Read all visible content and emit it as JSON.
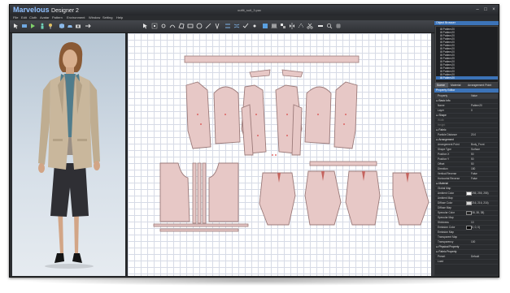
{
  "app": {
    "name": "Marvelous",
    "name_suffix": "Designer 2",
    "document_title": "outfit_suit_3.pac"
  },
  "menu": [
    "File",
    "Edit",
    "Cloth",
    "Avatar",
    "Pattern",
    "Environment",
    "Window",
    "Setting",
    "Help"
  ],
  "toolbar_3d_icons": [
    "select-icon",
    "transform-icon",
    "simulate-icon",
    "avatar-icon",
    "pin-icon",
    "fold-icon",
    "iron-icon",
    "camera-icon",
    "arrow-icon"
  ],
  "toolbar_2d_icons": [
    "select-pattern-icon",
    "edit-point-icon",
    "add-point-icon",
    "curve-icon",
    "polygon-icon",
    "rectangle-icon",
    "circle-icon",
    "internal-line-icon",
    "dart-icon",
    "segment-sewing-icon",
    "free-sewing-icon",
    "check-sewing-icon",
    "tack-icon",
    "texture-icon",
    "pleat-icon",
    "arrange-icon",
    "mirror-icon",
    "trace-icon",
    "cut-icon",
    "scale-icon",
    "zoom-icon",
    "grid-icon"
  ],
  "object_browser": {
    "title": "Object Browser",
    "items": [
      "Pattern20",
      "Pattern20",
      "Pattern20",
      "Pattern20",
      "Pattern20",
      "Pattern20",
      "Pattern20",
      "Pattern20",
      "Pattern20",
      "Pattern20",
      "Pattern20",
      "Pattern20",
      "Pattern20",
      "Pattern20",
      "Pattern20",
      "Pattern20"
    ],
    "selected_index": 15
  },
  "tabs": [
    "Scene",
    "Material",
    "Arrangement Point"
  ],
  "active_tab": 0,
  "property_editor": {
    "title": "Property Editor",
    "header_property": "Property",
    "header_value": "Value",
    "rows": [
      {
        "k": "Basic Info",
        "v": "",
        "sec": true
      },
      {
        "k": "Name",
        "v": "Pattern20"
      },
      {
        "k": "Layer",
        "v": "0"
      },
      {
        "k": "Shape",
        "v": "",
        "sec": true
      },
      {
        "k": "Width",
        "v": "",
        "dim": true
      },
      {
        "k": "Height",
        "v": "",
        "dim": true
      },
      {
        "k": "Fabric",
        "v": "",
        "sec": true
      },
      {
        "k": "Particle Distance",
        "v": "20.0"
      },
      {
        "k": "Arrangement",
        "v": "",
        "sec": true
      },
      {
        "k": "Arrangement Point",
        "v": "Body_Front"
      },
      {
        "k": "Shape Type",
        "v": "Surface"
      },
      {
        "k": "Position X",
        "v": "50"
      },
      {
        "k": "Position Y",
        "v": "50"
      },
      {
        "k": "Offset",
        "v": "50"
      },
      {
        "k": "Direction",
        "v": "180"
      },
      {
        "k": "Vertical Reverse",
        "v": "False"
      },
      {
        "k": "Horizontal Reverse",
        "v": "False"
      },
      {
        "k": "Material",
        "v": "",
        "sec": true
      },
      {
        "k": "Global Map",
        "v": ""
      },
      {
        "k": "Ambient Color",
        "v": "(255, 255, 255)",
        "swatch": "#ffffff"
      },
      {
        "k": "Ambient Map",
        "v": ""
      },
      {
        "k": "Diffuse Color",
        "v": "(216, 216, 216)",
        "swatch": "#d8d8d8"
      },
      {
        "k": "Diffuse Map",
        "v": ""
      },
      {
        "k": "Specular Color",
        "v": "(38, 38, 38)",
        "swatch": "#262626"
      },
      {
        "k": "Specular Map",
        "v": ""
      },
      {
        "k": "Shininess",
        "v": "10"
      },
      {
        "k": "Emission Color",
        "v": "(0, 0, 0)",
        "swatch": "#000000"
      },
      {
        "k": "Emission Map",
        "v": ""
      },
      {
        "k": "Transparent Map",
        "v": ""
      },
      {
        "k": "Transparency",
        "v": "100"
      },
      {
        "k": "Physical Property",
        "v": "",
        "sec": true
      },
      {
        "k": "Fabric Property",
        "v": "",
        "sec": true
      },
      {
        "k": "Preset",
        "v": "Default"
      },
      {
        "k": "Load",
        "v": ""
      }
    ]
  },
  "colors": {
    "accent": "#3c73b8",
    "pattern_fill": "#e7c8c6",
    "pattern_stroke": "#9b7a79",
    "grid": "#d7dbe6",
    "jacket": "#c9b79c",
    "shorts": "#2f2f34",
    "scarf": "#4f7c8c"
  }
}
